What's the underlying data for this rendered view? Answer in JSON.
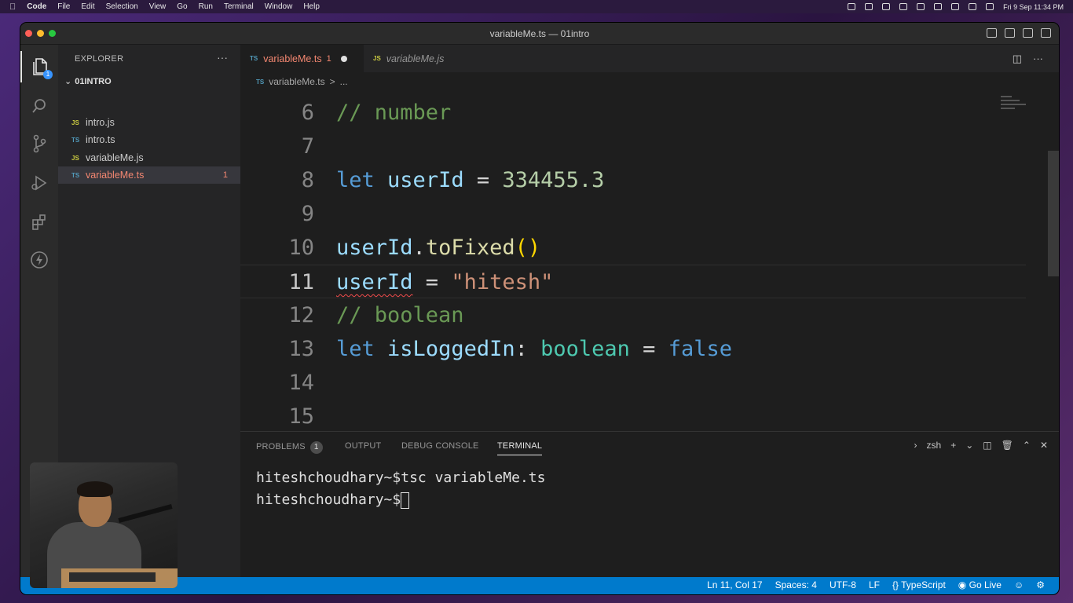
{
  "menubar": {
    "app": "Code",
    "items": [
      "File",
      "Edit",
      "Selection",
      "View",
      "Go",
      "Run",
      "Terminal",
      "Window",
      "Help"
    ],
    "clock": "Fri 9 Sep  11:34 PM"
  },
  "window": {
    "title": "variableMe.ts — 01intro"
  },
  "activity": {
    "explorer_badge": "1"
  },
  "explorer": {
    "header": "EXPLORER",
    "more": "···",
    "folder": "01INTRO",
    "files": [
      {
        "icon": "JS",
        "name": "intro.js"
      },
      {
        "icon": "TS",
        "name": "intro.ts"
      },
      {
        "icon": "JS",
        "name": "variableMe.js"
      },
      {
        "icon": "TS",
        "name": "variableMe.ts",
        "errors": "1"
      }
    ]
  },
  "tabs": [
    {
      "icon": "TS",
      "label": "variableMe.ts",
      "errors": "1"
    },
    {
      "icon": "JS",
      "label": "variableMe.js"
    }
  ],
  "breadcrumb": {
    "icon": "TS",
    "file": "variableMe.ts",
    "sep": ">",
    "rest": "..."
  },
  "code": {
    "lines": [
      {
        "n": "6"
      },
      {
        "n": "7"
      },
      {
        "n": "8"
      },
      {
        "n": "9"
      },
      {
        "n": "10"
      },
      {
        "n": "11"
      },
      {
        "n": "12"
      },
      {
        "n": "13"
      },
      {
        "n": "14"
      },
      {
        "n": "15"
      }
    ],
    "t6": "// number",
    "t8_kw": "let",
    "t8_var": "userId",
    "t8_eq": " = ",
    "t8_num": "334455.3",
    "t10_var": "userId",
    "t10_dot": ".",
    "t10_fn": "toFixed",
    "t10_par": "()",
    "t11_var": "userId",
    "t11_eq": " = ",
    "t11_str": "\"hitesh\"",
    "t12": "// boolean",
    "t13_kw": "let",
    "t13_var": "isLoggedIn",
    "t13_colon": ": ",
    "t13_type": "boolean",
    "t13_eq": " = ",
    "t13_val": "false"
  },
  "panel": {
    "tabs": {
      "problems": "PROBLEMS",
      "problems_count": "1",
      "output": "OUTPUT",
      "debug": "DEBUG CONSOLE",
      "terminal": "TERMINAL"
    },
    "shell": "zsh",
    "terminal_lines": [
      "hiteshchoudhary~$tsc variableMe.ts",
      "hiteshchoudhary~$"
    ]
  },
  "status": {
    "position": "Ln 11, Col 17",
    "spaces": "Spaces: 4",
    "encoding": "UTF-8",
    "eol": "LF",
    "language": "{} TypeScript",
    "golive": "Go Live"
  },
  "colors": {
    "statusbar": "#007acc",
    "editor_bg": "#1e1e1e",
    "error": "#f48771"
  }
}
